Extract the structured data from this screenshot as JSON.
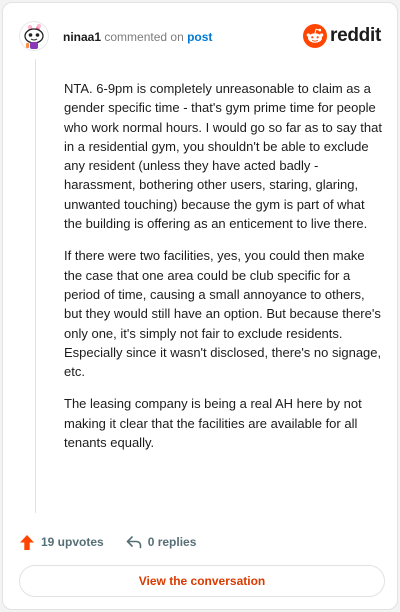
{
  "comment": {
    "username": "ninaa1",
    "action_text": "commented on",
    "post_link": "post",
    "paragraphs": [
      "NTA. 6-9pm is completely unreasonable to claim as a gender specific time - that's gym prime time for people who work normal hours. I would go so far as to say that in a residential gym, you shouldn't be able to exclude any resident (unless they have acted badly - harassment, bothering other users, staring, glaring, unwanted touching) because the gym is part of what the building is offering as an enticement to live there.",
      "If there were two facilities, yes, you could then make the case that one area could be club specific for a period of time, causing a small annoyance to others, but they would still have an option. But because there's only one, it's simply not fair to exclude residents. Especially since it wasn't disclosed, there's no signage, etc.",
      "The leasing company is being a real AH here by not making it clear that the facilities are available for all tenants equally."
    ],
    "upvotes": "19 upvotes",
    "replies": "0 replies"
  },
  "brand": {
    "name": "reddit",
    "icon": "reddit-logo-icon",
    "color": "#ff4500"
  },
  "avatar_icon": "snoo-avatar-icon",
  "upvote_icon": "upvote-arrow-icon",
  "reply_icon": "reply-arrow-icon",
  "view_button": "View the conversation",
  "colors": {
    "accent": "#ff4500",
    "link": "#0079d3",
    "button_text": "#d93a00"
  }
}
